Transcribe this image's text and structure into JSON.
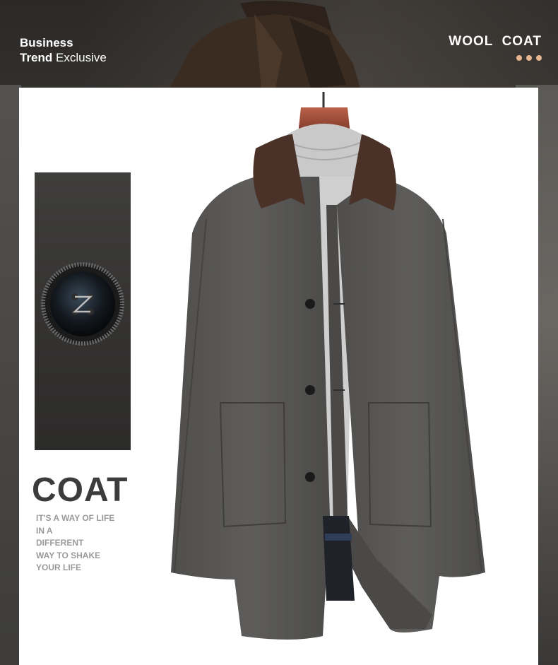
{
  "header": {
    "left_line1": "Business",
    "left_line2_bold": "Trend",
    "left_line2_rest": " Exclusive",
    "right_title": "WOOL  COAT"
  },
  "side": {
    "heading": "COAT",
    "tagline": [
      "IT'S A WAY OF LIFE",
      "IN A",
      "DIFFERENT",
      "WAY TO SHAKE",
      "YOUR LIFE"
    ]
  },
  "colors": {
    "accent_dots": "#e6b48e",
    "coat": "#5b5a58",
    "collar": "#4a3228",
    "heading": "#3c3c3c",
    "tagline": "#9a9a9a"
  },
  "images": {
    "model": "man-in-brown-coat-photo",
    "swatch": "wool-fabric-button-closeup",
    "product": "grey-wool-coat-with-brown-collar"
  }
}
